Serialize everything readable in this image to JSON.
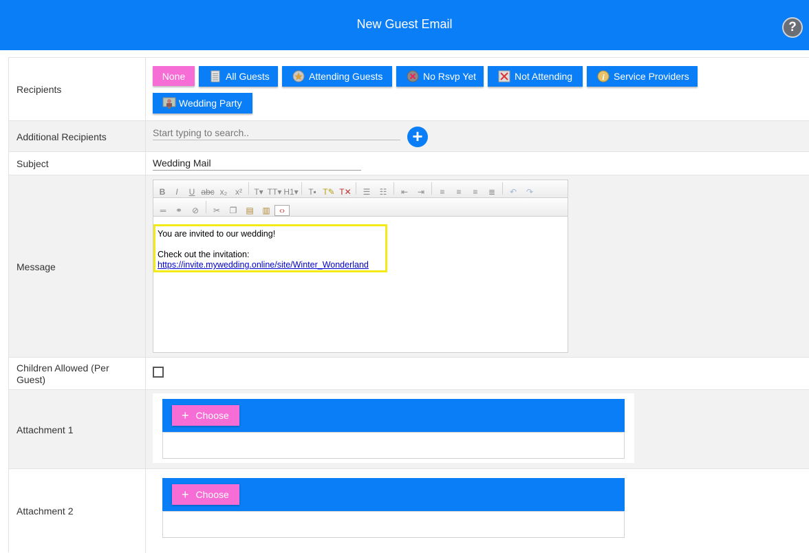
{
  "header": {
    "title": "New Guest Email",
    "help_glyph": "?"
  },
  "labels": {
    "recipients": "Recipients",
    "additional": "Additional Recipients",
    "subject": "Subject",
    "message": "Message",
    "children": "Children Allowed (Per Guest)",
    "attachment1": "Attachment 1",
    "attachment2": "Attachment 2"
  },
  "recipient_buttons": [
    {
      "label": "None",
      "icon": "none"
    },
    {
      "label": "All Guests",
      "icon": "list-icon"
    },
    {
      "label": "Attending Guests",
      "icon": "star-badge-icon"
    },
    {
      "label": "No Rsvp Yet",
      "icon": "x-circle-icon"
    },
    {
      "label": "Not Attending",
      "icon": "x-box-icon"
    },
    {
      "label": "Service Providers",
      "icon": "info-icon"
    },
    {
      "label": "Wedding Party",
      "icon": "people-icon"
    }
  ],
  "additional": {
    "placeholder": "Start typing to search..",
    "add_glyph": "+"
  },
  "subject": {
    "value": "Wedding Mail"
  },
  "message": {
    "line1": "You are invited to our wedding!",
    "line2": "Check out the invitation:",
    "link": "https://invite.mywedding.online/site/Winter_Wonderland"
  },
  "children_allowed": false,
  "attachments": [
    {
      "choose_label": "Choose",
      "plus_glyph": "+"
    },
    {
      "choose_label": "Choose",
      "plus_glyph": "+"
    }
  ],
  "colors": {
    "primary": "#0a7ef7",
    "pink": "#f66dd5",
    "highlight": "#f3ea16"
  }
}
